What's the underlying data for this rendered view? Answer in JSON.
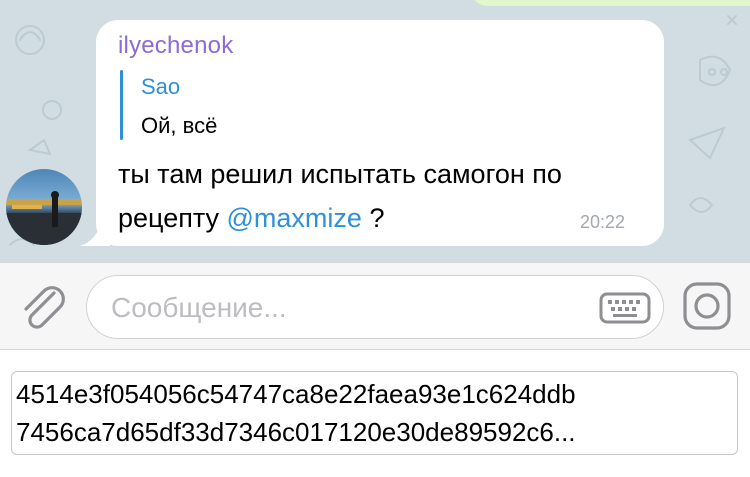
{
  "chat": {
    "message": {
      "sender": "ilyechenok",
      "reply": {
        "author": "Sao",
        "text": "Ой, всё"
      },
      "text_before": "ты там решил испытать самогон по рецепту ",
      "mention": "@maxmize",
      "text_after": " ?",
      "time": "20:22"
    }
  },
  "composer": {
    "placeholder": "Сообщение...",
    "attach_icon": "paperclip-icon",
    "keyboard_icon": "keyboard-icon",
    "camera_icon": "camera-icon"
  },
  "hash": {
    "line1": "4514e3f054056c54747ca8e22faea93e1c624ddb",
    "line2": "7456ca7d65df33d7346c017120e30de89592c6..."
  },
  "colors": {
    "chat_background": "#d1dde3",
    "sender_name": "#8c6bd6",
    "link": "#2f8fd8",
    "time": "#a3a9af",
    "placeholder": "#bdbdc1"
  }
}
